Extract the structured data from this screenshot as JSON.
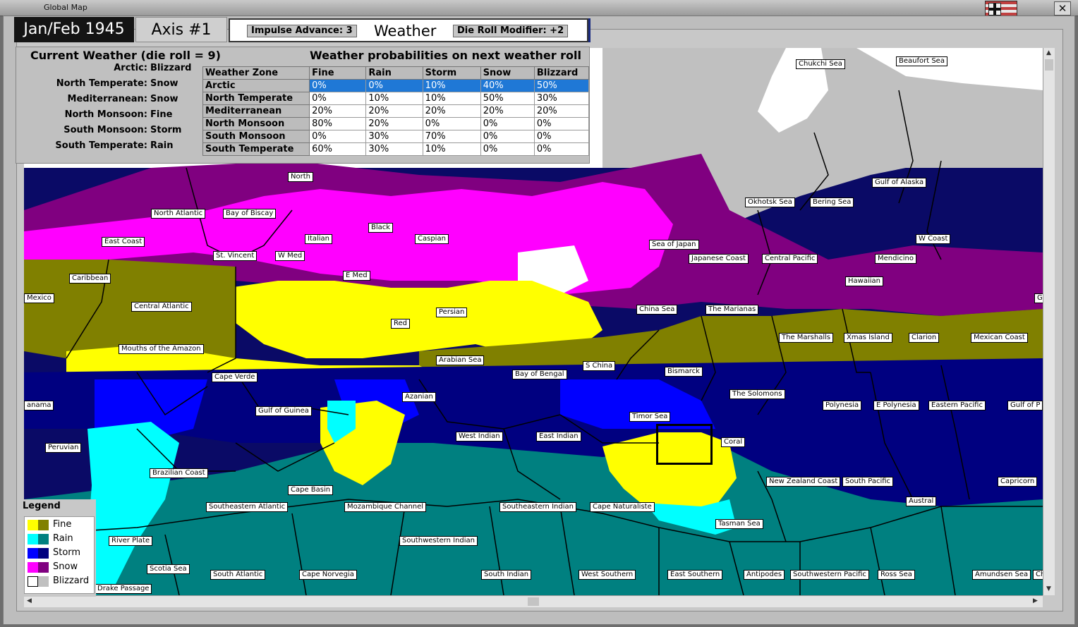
{
  "window": {
    "title": "Global Map",
    "close_glyph": "✕"
  },
  "header": {
    "date": "Jan/Feb 1945",
    "side": "Axis #1",
    "impulse_label": "Impulse Advance: 3",
    "weather_label": "Weather",
    "die_roll_label": "Die Roll Modifier: +2"
  },
  "current_weather": {
    "title": "Current Weather (die roll = 9)",
    "zones": [
      {
        "name": "Arctic:",
        "value": "Blizzard"
      },
      {
        "name": "North Temperate:",
        "value": "Snow"
      },
      {
        "name": "Mediterranean:",
        "value": "Snow"
      },
      {
        "name": "North Monsoon:",
        "value": "Fine"
      },
      {
        "name": "South Monsoon:",
        "value": "Storm"
      },
      {
        "name": "South Temperate:",
        "value": "Rain"
      }
    ]
  },
  "probabilities": {
    "title": "Weather probabilities on next weather roll",
    "headers": [
      "Weather Zone",
      "Fine",
      "Rain",
      "Storm",
      "Snow",
      "Blizzard"
    ],
    "rows": [
      {
        "zone": "Arctic",
        "values": [
          "0%",
          "0%",
          "10%",
          "40%",
          "50%"
        ],
        "selected": true
      },
      {
        "zone": "North Temperate",
        "values": [
          "0%",
          "10%",
          "10%",
          "50%",
          "30%"
        ]
      },
      {
        "zone": "Mediterranean",
        "values": [
          "20%",
          "20%",
          "20%",
          "20%",
          "20%"
        ]
      },
      {
        "zone": "North Monsoon",
        "values": [
          "80%",
          "20%",
          "0%",
          "0%",
          "0%"
        ]
      },
      {
        "zone": "South Monsoon",
        "values": [
          "0%",
          "30%",
          "70%",
          "0%",
          "0%"
        ]
      },
      {
        "zone": "South Temperate",
        "values": [
          "60%",
          "30%",
          "10%",
          "0%",
          "0%"
        ]
      }
    ]
  },
  "legend": {
    "title": "Legend",
    "items": [
      {
        "label": "Fine",
        "land": "#ffff00",
        "sea": "#808000"
      },
      {
        "label": "Rain",
        "land": "#00ffff",
        "sea": "#008080"
      },
      {
        "label": "Storm",
        "land": "#0000ff",
        "sea": "#000080"
      },
      {
        "label": "Snow",
        "land": "#ff00ff",
        "sea": "#800080"
      },
      {
        "label": "Blizzard",
        "land": "#ffffff",
        "sea": "#c0c0c0"
      }
    ]
  },
  "sea_areas": [
    "Chukchi Sea",
    "Beaufort Sea",
    "Gulf of Alaska",
    "Okhotsk Sea",
    "Bering Sea",
    "North",
    "North Atlantic",
    "Bay of Biscay",
    "Black",
    "Italian",
    "Caspian",
    "East Coast",
    "St. Vincent",
    "W Med",
    "Sea of Japan",
    "Japanese Coast",
    "Central Pacific",
    "W Coast",
    "Mendicino",
    "Caribbean",
    "E Med",
    "Hawaiian",
    "Mexico",
    "Central Atlantic",
    "Persian",
    "China Sea",
    "The Marianas",
    "Red",
    "The Marshalls",
    "Xmas Island",
    "Clarion",
    "Mexican Coast",
    "Mouths of the Amazon",
    "Arabian Sea",
    "S China",
    "Bismarck",
    "Cape Verde",
    "Bay of Bengal",
    "The Solomons",
    "Azanian",
    "anama",
    "Gulf of Guinea",
    "Polynesia",
    "E Polynesia",
    "Eastern Pacific",
    "Gulf of P",
    "Timor Sea",
    "West Indian",
    "East Indian",
    "Coral",
    "Peruvian",
    "Brazilian Coast",
    "New Zealand Coast",
    "South Pacific",
    "Capricorn",
    "Cape Basin",
    "Austral",
    "Southeastern Atlantic",
    "Mozambique Channel",
    "Southeastern Indian",
    "Cape Naturaliste",
    "Tasman Sea",
    "River Plate",
    "Southwestern Indian",
    "Scotia Sea",
    "South Atlantic",
    "Cape Norvegia",
    "South Indian",
    "West Southern",
    "East Southern",
    "Antipodes",
    "Southwestern Pacific",
    "Ross Sea",
    "Amundsen Sea",
    "Ch",
    "Drake Passage",
    "G"
  ],
  "scroll": {
    "up": "▲",
    "down": "▼",
    "left": "◀",
    "right": "▶"
  }
}
